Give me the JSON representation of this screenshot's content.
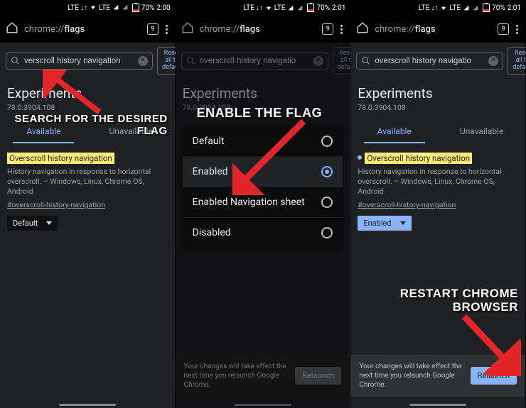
{
  "status": {
    "battery": "70%",
    "time1": "2:00",
    "time2": "2:01",
    "lte": "LTE"
  },
  "toolbar": {
    "url_prefix": "chrome://",
    "url_page": "flags",
    "tab_count": "9"
  },
  "search": {
    "value_full": "verscroll history navigation",
    "value_trim": "overscroll history navigatio",
    "reset": "Reset all to default"
  },
  "page": {
    "heading": "Experiments",
    "version": "78.0.3904.108",
    "tab_available": "Available",
    "tab_unavailable": "Unavailable"
  },
  "flag": {
    "title": "Overscroll history navigation",
    "desc": "History navigation in response to horizontal overscroll. – Windows, Linux, Chrome OS, Android",
    "link": "#overscroll-history-navigation",
    "select_default": "Default",
    "select_enabled": "Enabled"
  },
  "dropdown": {
    "options": [
      "Default",
      "Enabled",
      "Enabled Navigation sheet",
      "Disabled"
    ],
    "selected": 1
  },
  "relaunch": {
    "msg": "Your changes will take effect the next time you relaunch Google Chrome.",
    "btn": "Relaunch"
  },
  "anno": {
    "a1": "SEARCH FOR THE DESIRED FLAG",
    "a2": "ENABLE THE FLAG",
    "a3": "RESTART CHROME BROWSER"
  }
}
